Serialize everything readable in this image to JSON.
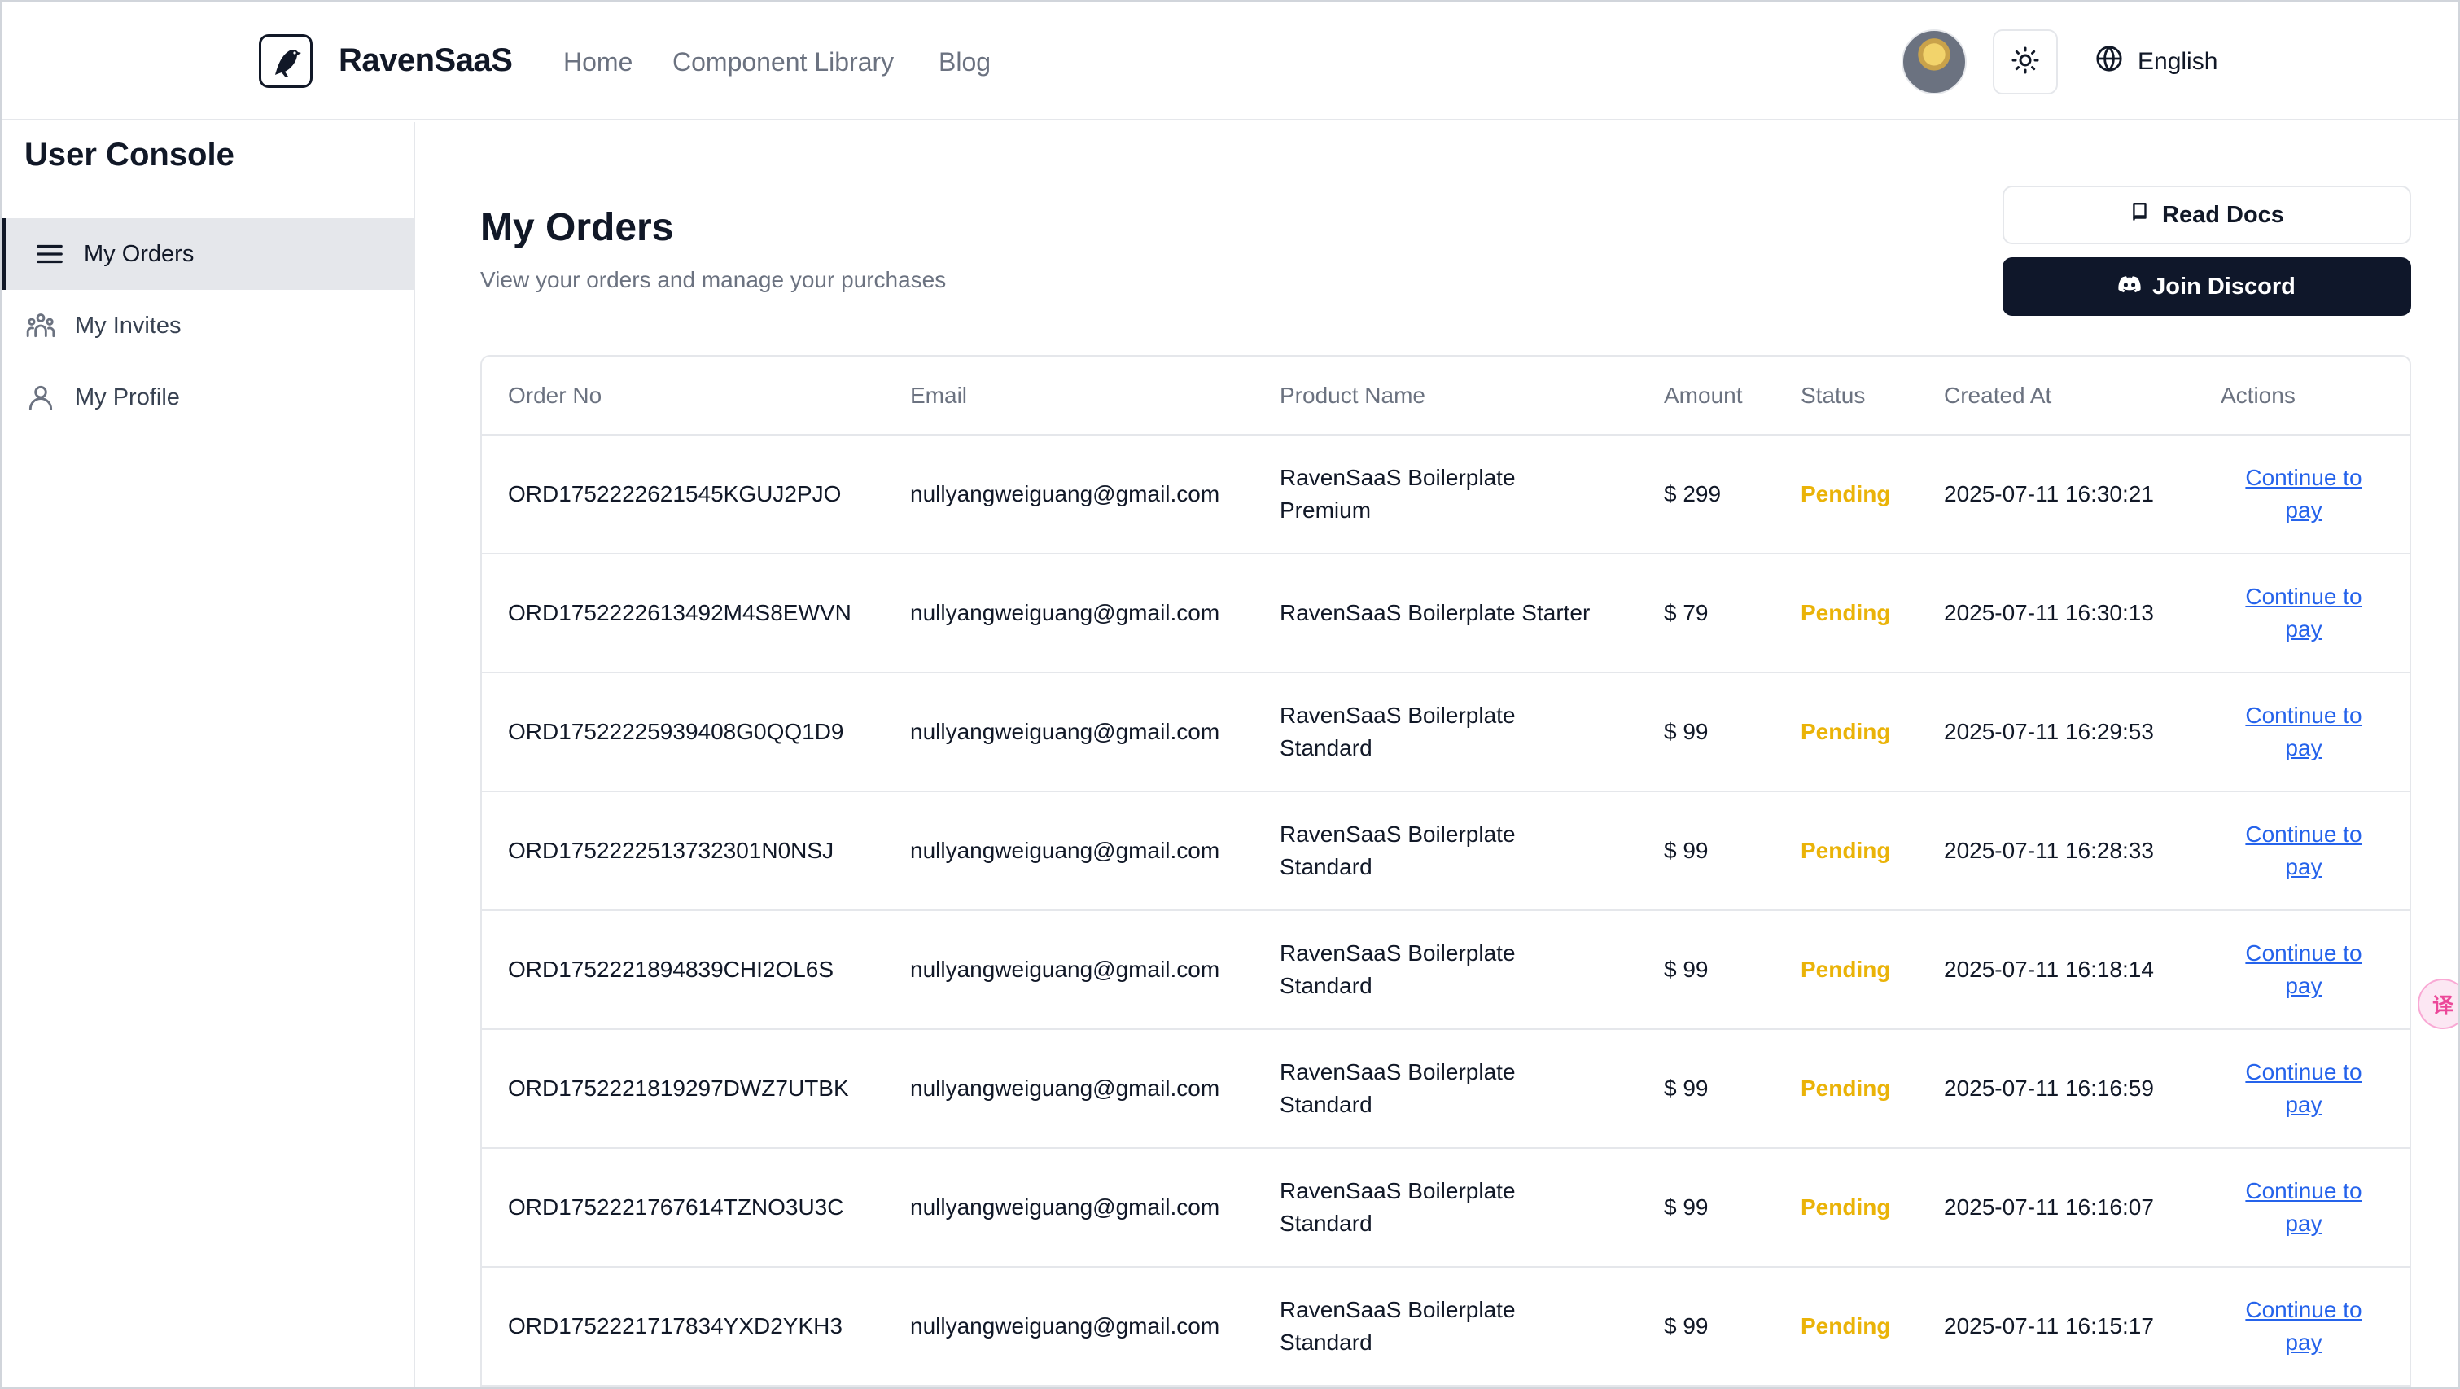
{
  "header": {
    "brand": "RavenSaaS",
    "nav": [
      "Home",
      "Component Library",
      "Blog"
    ],
    "language": "English"
  },
  "sidebar": {
    "title": "User Console",
    "items": [
      {
        "label": "My Orders",
        "icon": "menu-lines-icon",
        "active": true
      },
      {
        "label": "My Invites",
        "icon": "users-icon",
        "active": false
      },
      {
        "label": "My Profile",
        "icon": "user-icon",
        "active": false
      }
    ]
  },
  "main": {
    "title": "My Orders",
    "subtitle": "View your orders and manage your purchases",
    "read_docs": "Read Docs",
    "join_discord": "Join Discord"
  },
  "table": {
    "columns": [
      "Order No",
      "Email",
      "Product Name",
      "Amount",
      "Status",
      "Created At",
      "Actions"
    ],
    "rows": [
      {
        "order_no": "ORD1752222621545KGUJ2PJO",
        "email": "nullyangweiguang@gmail.com",
        "product_line1": "RavenSaaS Boilerplate",
        "product_line2": "Premium",
        "amount": "$ 299",
        "status": "Pending",
        "created_at": "2025-07-11 16:30:21",
        "action_line1": "Continue to",
        "action_line2": "pay"
      },
      {
        "order_no": "ORD1752222613492M4S8EWVN",
        "email": "nullyangweiguang@gmail.com",
        "product_line1": "RavenSaaS Boilerplate Starter",
        "product_line2": "",
        "amount": "$ 79",
        "status": "Pending",
        "created_at": "2025-07-11 16:30:13",
        "action_line1": "Continue to",
        "action_line2": "pay"
      },
      {
        "order_no": "ORD17522225939408G0QQ1D9",
        "email": "nullyangweiguang@gmail.com",
        "product_line1": "RavenSaaS Boilerplate",
        "product_line2": "Standard",
        "amount": "$ 99",
        "status": "Pending",
        "created_at": "2025-07-11 16:29:53",
        "action_line1": "Continue to",
        "action_line2": "pay"
      },
      {
        "order_no": "ORD1752222513732301N0NSJ",
        "email": "nullyangweiguang@gmail.com",
        "product_line1": "RavenSaaS Boilerplate",
        "product_line2": "Standard",
        "amount": "$ 99",
        "status": "Pending",
        "created_at": "2025-07-11 16:28:33",
        "action_line1": "Continue to",
        "action_line2": "pay"
      },
      {
        "order_no": "ORD1752221894839CHI2OL6S",
        "email": "nullyangweiguang@gmail.com",
        "product_line1": "RavenSaaS Boilerplate",
        "product_line2": "Standard",
        "amount": "$ 99",
        "status": "Pending",
        "created_at": "2025-07-11 16:18:14",
        "action_line1": "Continue to",
        "action_line2": "pay"
      },
      {
        "order_no": "ORD1752221819297DWZ7UTBK",
        "email": "nullyangweiguang@gmail.com",
        "product_line1": "RavenSaaS Boilerplate",
        "product_line2": "Standard",
        "amount": "$ 99",
        "status": "Pending",
        "created_at": "2025-07-11 16:16:59",
        "action_line1": "Continue to",
        "action_line2": "pay"
      },
      {
        "order_no": "ORD1752221767614TZNO3U3C",
        "email": "nullyangweiguang@gmail.com",
        "product_line1": "RavenSaaS Boilerplate",
        "product_line2": "Standard",
        "amount": "$ 99",
        "status": "Pending",
        "created_at": "2025-07-11 16:16:07",
        "action_line1": "Continue to",
        "action_line2": "pay"
      },
      {
        "order_no": "ORD1752221717834YXD2YKH3",
        "email": "nullyangweiguang@gmail.com",
        "product_line1": "RavenSaaS Boilerplate",
        "product_line2": "Standard",
        "amount": "$ 99",
        "status": "Pending",
        "created_at": "2025-07-11 16:15:17",
        "action_line1": "Continue to",
        "action_line2": "pay"
      }
    ]
  },
  "colors": {
    "pending": "#eab308",
    "link": "#2563eb",
    "primary_button": "#0f172a",
    "active_sidebar_bg": "#e5e7eb"
  },
  "icons": {
    "brand_logo": "raven-logo-icon",
    "theme_toggle": "sun-icon",
    "language": "globe-icon",
    "read_docs": "book-icon",
    "join_discord": "discord-icon",
    "translate": "translate-icon"
  }
}
